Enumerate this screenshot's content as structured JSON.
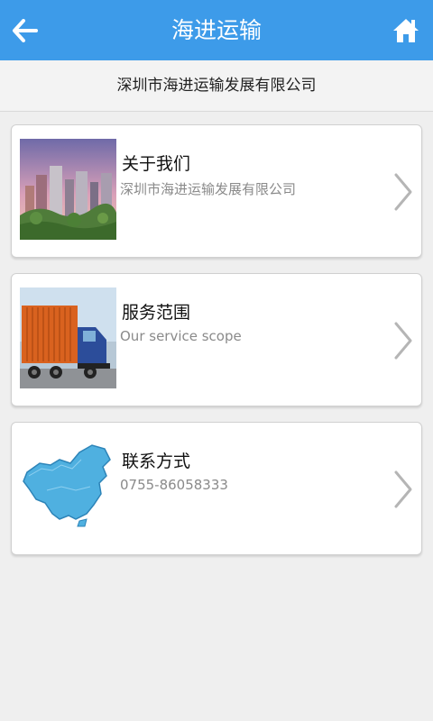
{
  "app": {
    "title": "海进运输",
    "back_icon": "back-arrow-icon",
    "home_icon": "home-icon",
    "accent_color": "#3d9be9"
  },
  "company": {
    "name": "深圳市海进运输发展有限公司"
  },
  "menu": [
    {
      "title": "关于我们",
      "subtitle": "深圳市海进运输发展有限公司",
      "image": "city-skyline-image"
    },
    {
      "title": "服务范围",
      "subtitle": "Our service scope",
      "image": "container-truck-image"
    },
    {
      "title": "联系方式",
      "subtitle": "0755-86058333",
      "image": "china-map-image"
    }
  ]
}
